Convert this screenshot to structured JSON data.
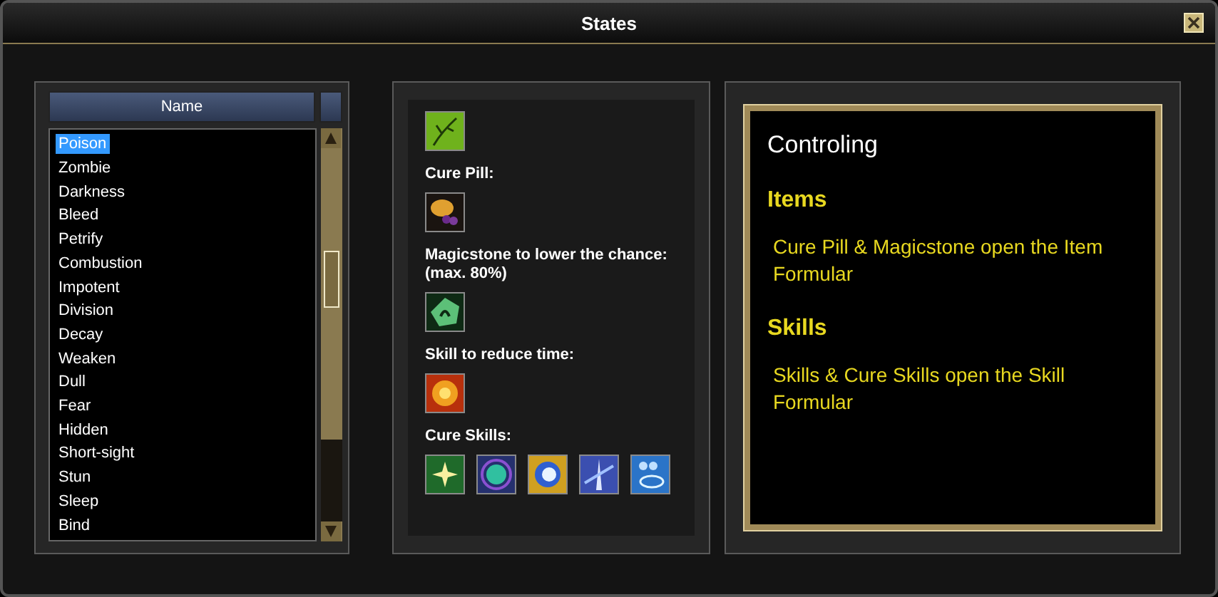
{
  "window": {
    "title": "States"
  },
  "list": {
    "column": "Name",
    "items": [
      {
        "label": "Poison",
        "selected": true
      },
      {
        "label": "Zombie",
        "selected": false
      },
      {
        "label": "Darkness",
        "selected": false
      },
      {
        "label": "Bleed",
        "selected": false
      },
      {
        "label": "Petrify",
        "selected": false
      },
      {
        "label": "Combustion",
        "selected": false
      },
      {
        "label": "Impotent",
        "selected": false
      },
      {
        "label": "Division",
        "selected": false
      },
      {
        "label": "Decay",
        "selected": false
      },
      {
        "label": "Weaken",
        "selected": false
      },
      {
        "label": "Dull",
        "selected": false
      },
      {
        "label": "Fear",
        "selected": false
      },
      {
        "label": "Hidden",
        "selected": false
      },
      {
        "label": "Short-sight",
        "selected": false
      },
      {
        "label": "Stun",
        "selected": false
      },
      {
        "label": "Sleep",
        "selected": false
      },
      {
        "label": "Bind",
        "selected": false
      }
    ]
  },
  "details": [
    {
      "icons": [
        {
          "kind": "leaf"
        }
      ]
    },
    {
      "label": "Cure Pill:",
      "icons": [
        {
          "kind": "pill"
        }
      ]
    },
    {
      "label": "Magicstone to lower the chance: (max. 80%)",
      "icons": [
        {
          "kind": "stone"
        }
      ]
    },
    {
      "label": "Skill to reduce time:",
      "icons": [
        {
          "kind": "burst"
        }
      ]
    },
    {
      "label": "Cure Skills:",
      "icons": [
        {
          "kind": "sparkle"
        },
        {
          "kind": "orb"
        },
        {
          "kind": "ring"
        },
        {
          "kind": "beam"
        },
        {
          "kind": "ripple"
        }
      ]
    }
  ],
  "info": {
    "title": "Controling",
    "sections": [
      {
        "heading": "Items",
        "text": "Cure Pill & Magicstone open the Item Formular"
      },
      {
        "heading": "Skills",
        "text": "Skills & Cure Skills open the Skill Formular"
      }
    ]
  }
}
